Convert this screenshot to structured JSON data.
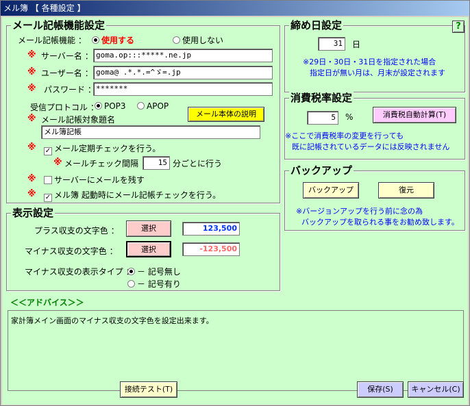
{
  "window": {
    "title": "メル簿 【 各種設定 】"
  },
  "mail": {
    "title": "メール記帳機能設定",
    "func_label": "メール記帳機能 ：",
    "use_label": "使用する",
    "nouse_label": "使用しない",
    "server_label": "サーバー名 ：",
    "server_value": "goma.op:::*****.ne.jp",
    "user_label": "ユーザー名 ：",
    "user_value": "goma@     .*.*.=^ゞ=.jp",
    "pass_label": "パスワード ：",
    "pass_value": "*******",
    "protocol_label": "受信プロトコル ：",
    "pop3_label": "POP3",
    "apop_label": "APOP",
    "body_button": "メール本体の説明",
    "subject_label": "メール記帳対象題名",
    "subject_value": "メル簿記帳",
    "periodic_label": "メール定期チェックを行う。",
    "interval_label": "メールチェック間隔 ：",
    "interval_value": "15",
    "interval_unit": "分ごとに行う",
    "keep_label": "サーバーにメールを残す",
    "startup_label": "メル簿  起動時にメール記帳チェックを行う。",
    "mark": "※"
  },
  "display": {
    "title": "表示設定",
    "plus_label": "プラス収支の文字色 ：",
    "plus_button": "選択",
    "plus_sample": "123,500",
    "minus_label": "マイナス収支の文字色 ：",
    "minus_button": "選択",
    "minus_sample": "-123,500",
    "type_label": "マイナス収支の表示タイプ ：",
    "type_opt1": "－ 記号無し",
    "type_opt2": "－ 記号有り",
    "colors": {
      "plus": "#0033ff",
      "minus": "#ff6666"
    }
  },
  "closing": {
    "title": "締め日設定",
    "help_icon": "?",
    "day_value": "31",
    "day_unit": "日",
    "note1": "※29日・30日・31日を指定された場合",
    "note2": "指定日が無い月は、月末が設定されます"
  },
  "tax": {
    "title": "消費税率設定",
    "rate_value": "5",
    "rate_unit": "%",
    "auto_button": "消費税自動計算(T)",
    "note1": "※ここで消費税率の変更を行っても",
    "note2": "既に記帳されているデータには反映されません"
  },
  "backup": {
    "title": "バックアップ",
    "backup_button": "バックアップ",
    "restore_button": "復元",
    "note1": "※バージョンアップを行う前に念の為",
    "note2": "バックアップを取られる事をお勧め致します。"
  },
  "advice": {
    "title": "＜＜アドバイス＞＞",
    "text": "家計簿メイン画面のマイナス収支の文字色を設定出来ます。"
  },
  "footer": {
    "test_button": "接続テスト(T)",
    "save_button": "保存(S)",
    "cancel_button": "キャンセル(C)"
  }
}
